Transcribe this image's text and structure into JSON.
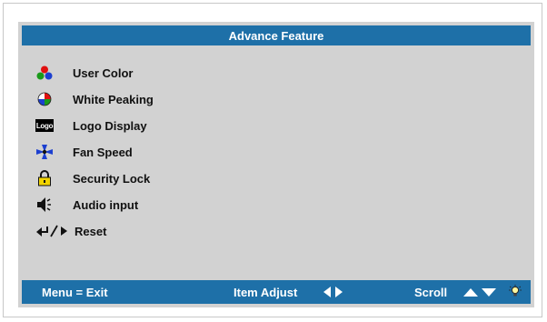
{
  "header": {
    "title": "Advance Feature"
  },
  "menu": {
    "items": [
      {
        "label": "User Color",
        "icon": "user-color-icon"
      },
      {
        "label": "White Peaking",
        "icon": "white-peaking-icon"
      },
      {
        "label": "Logo Display",
        "icon": "logo-display-icon",
        "icon_text": "Logo"
      },
      {
        "label": "Fan Speed",
        "icon": "fan-speed-icon"
      },
      {
        "label": "Security Lock",
        "icon": "security-lock-icon"
      },
      {
        "label": "Audio input",
        "icon": "audio-input-icon"
      },
      {
        "label": "Reset",
        "icon": "reset-icon"
      }
    ]
  },
  "footer": {
    "menu_exit": "Menu = Exit",
    "item_adjust": "Item Adjust",
    "scroll": "Scroll"
  },
  "colors": {
    "header_bg": "#1e70a8",
    "panel_bg": "#d2d2d2",
    "lock_yellow": "#f2d400"
  }
}
